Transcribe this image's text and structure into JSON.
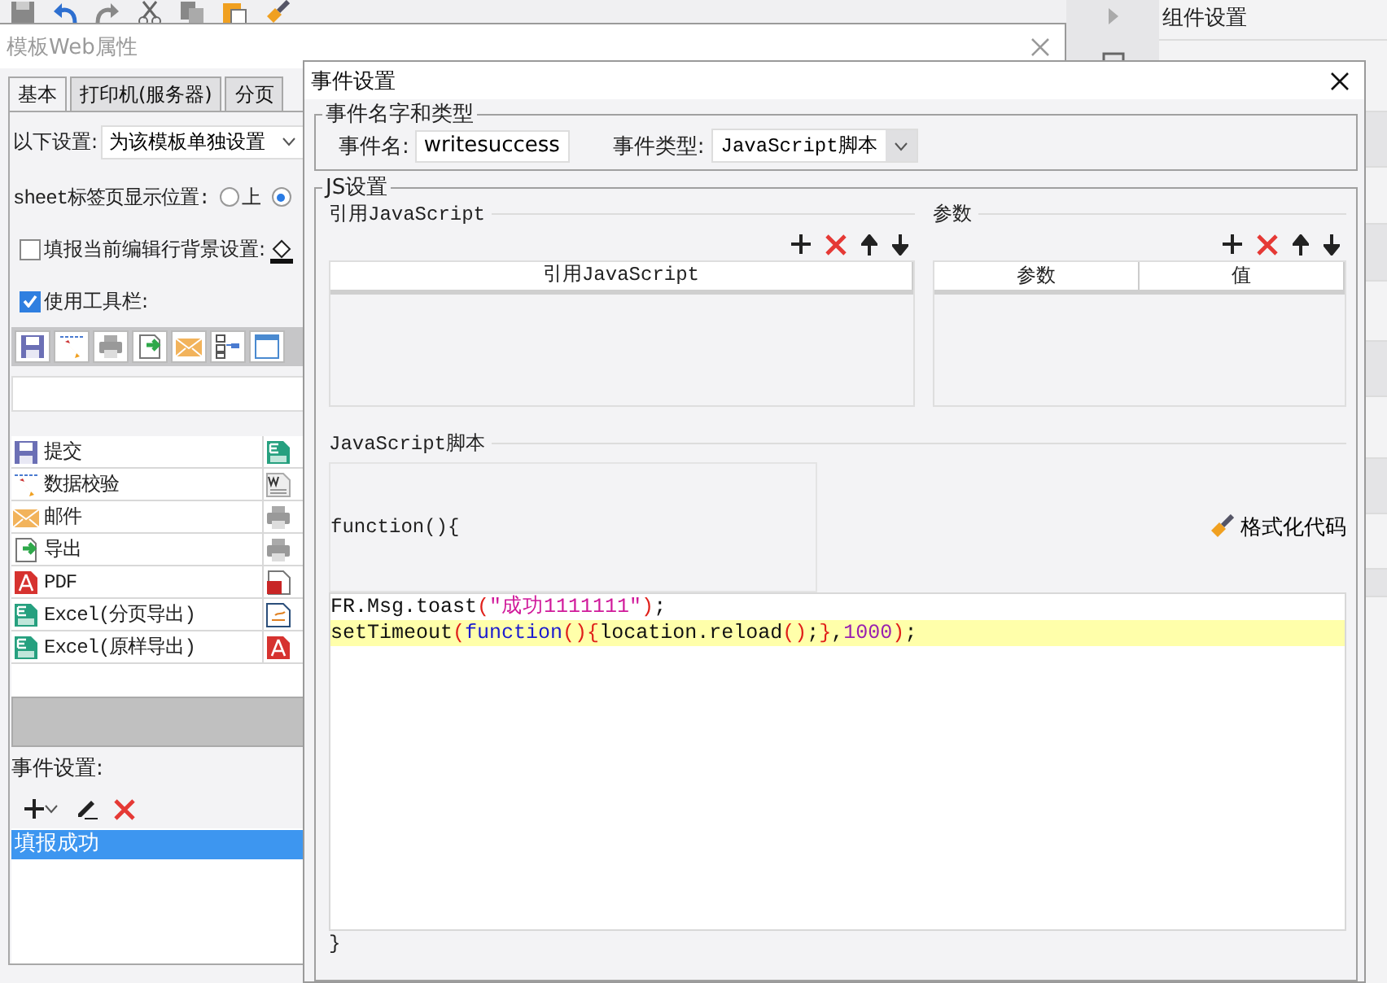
{
  "app": {
    "right_panel": {
      "title": "组件设置"
    }
  },
  "web_dialog": {
    "title": "模板Web属性",
    "tabs": [
      {
        "label": "基本",
        "selected": true
      },
      {
        "label": "打印机(服务器)",
        "selected": false
      },
      {
        "label": "分页",
        "selected": false
      }
    ],
    "setting": {
      "label": "以下设置:",
      "value": "为该模板单独设置"
    },
    "sheet_position": {
      "label": "sheet标签页显示位置:",
      "options": [
        {
          "label": "上",
          "selected": false
        },
        {
          "selected": true
        }
      ]
    },
    "row_background": {
      "label": "填报当前编辑行背景设置:",
      "checked": false
    },
    "use_toolbar": {
      "label": "使用工具栏:",
      "checked": true
    },
    "buttons": [
      {
        "label": "提交",
        "kind": "save"
      },
      {
        "label": "数据校验",
        "kind": "pencil"
      },
      {
        "label": "邮件",
        "kind": "mail"
      },
      {
        "label": "导出",
        "kind": "export"
      },
      {
        "label": "PDF",
        "kind": "pdf"
      },
      {
        "label": "Excel(分页导出)",
        "kind": "excel"
      },
      {
        "label": "Excel(原样导出)",
        "kind": "excel"
      }
    ],
    "right_icons": [
      {
        "kind": "excel"
      },
      {
        "kind": "word"
      },
      {
        "kind": "print"
      },
      {
        "kind": "print"
      },
      {
        "kind": "flash"
      },
      {
        "kind": "doc"
      },
      {
        "kind": "pdf"
      }
    ],
    "events": {
      "label": "事件设置:",
      "items": [
        {
          "label": "填报成功",
          "selected": true
        }
      ]
    }
  },
  "event_dialog": {
    "title": "事件设置",
    "name_group": {
      "title": "事件名字和类型",
      "name_label": "事件名:",
      "name_value": "writesuccess",
      "type_label": "事件类型:",
      "type_value": "JavaScript脚本"
    },
    "js_group": {
      "title": "JS设置",
      "refs": {
        "title": "引用JavaScript",
        "columns": [
          "引用JavaScript"
        ]
      },
      "params": {
        "title": "参数",
        "columns": [
          "参数",
          "值"
        ]
      },
      "script": {
        "title": "JavaScript脚本",
        "header": "function(){",
        "format_button": "格式化代码",
        "lines": [
          {
            "highlighted": false,
            "tokens": [
              {
                "kind": "plain",
                "text": "FR.Msg.toast"
              },
              {
                "kind": "paren",
                "text": "("
              },
              {
                "kind": "string",
                "text": "\"成功1111111\""
              },
              {
                "kind": "paren",
                "text": ")"
              },
              {
                "kind": "plain",
                "text": ";"
              }
            ]
          },
          {
            "highlighted": true,
            "tokens": [
              {
                "kind": "plain",
                "text": "setTimeout"
              },
              {
                "kind": "paren",
                "text": "("
              },
              {
                "kind": "keyword",
                "text": "function"
              },
              {
                "kind": "paren",
                "text": "(){"
              },
              {
                "kind": "plain",
                "text": "location.reload"
              },
              {
                "kind": "paren",
                "text": "()"
              },
              {
                "kind": "plain",
                "text": ";"
              },
              {
                "kind": "paren",
                "text": "}"
              },
              {
                "kind": "plain",
                "text": ","
              },
              {
                "kind": "number",
                "text": "1000"
              },
              {
                "kind": "paren",
                "text": ")"
              },
              {
                "kind": "plain",
                "text": ";"
              }
            ]
          }
        ],
        "footer": "}"
      }
    }
  }
}
